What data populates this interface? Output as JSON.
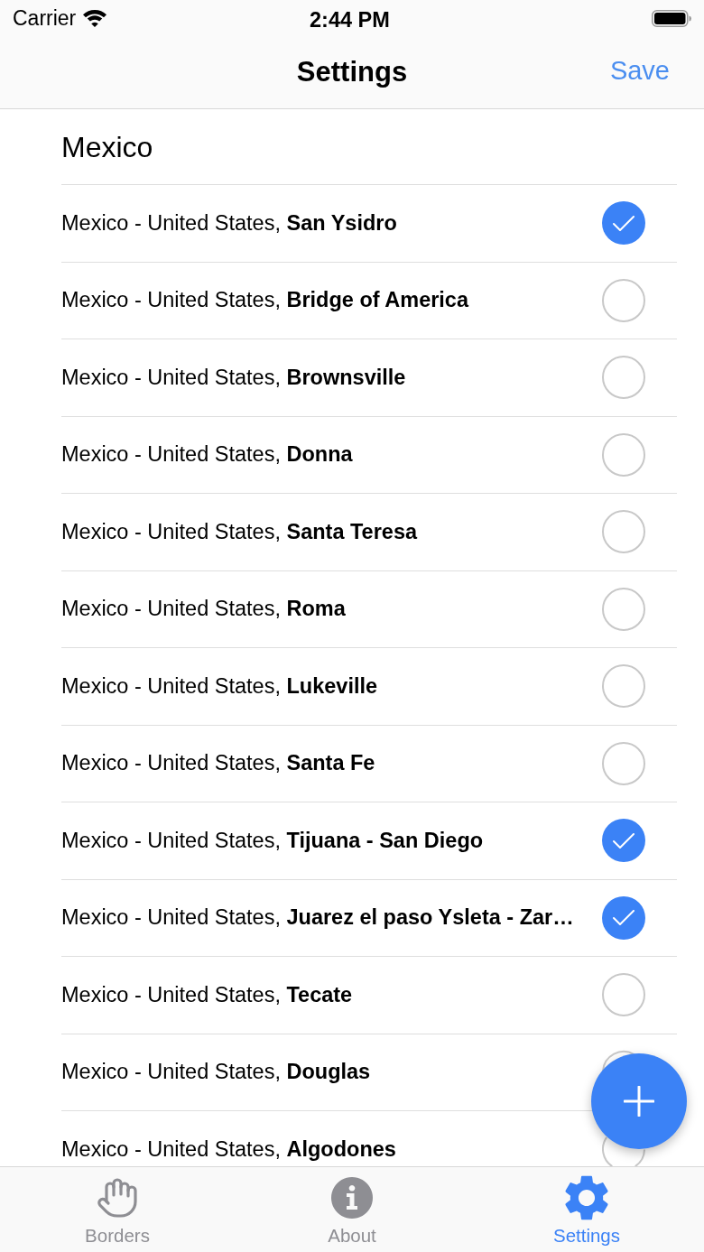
{
  "status_bar": {
    "carrier": "Carrier",
    "time": "2:44 PM"
  },
  "nav_bar": {
    "title": "Settings",
    "action": "Save"
  },
  "section": {
    "title": "Mexico",
    "rows": [
      {
        "text": "Mexico - United States, **San Ysidro**",
        "selected": true
      },
      {
        "text": "Mexico - United States, **Bridge of America**",
        "selected": false
      },
      {
        "text": "Mexico - United States, **Brownsville**",
        "selected": false
      },
      {
        "text": "Mexico - United States, **Donna**",
        "selected": false
      },
      {
        "text": "Mexico - United States, **Santa Teresa**",
        "selected": false
      },
      {
        "text": "Mexico - United States, **Roma**",
        "selected": false
      },
      {
        "text": "Mexico - United States, **Lukeville**",
        "selected": false
      },
      {
        "text": "Mexico - United States, **Santa Fe**",
        "selected": false
      },
      {
        "text": "Mexico - United States, **Tijuana - San Diego**",
        "selected": true
      },
      {
        "text": "Mexico - United States, **Juarez el paso Ysleta - Zar…**",
        "selected": true
      },
      {
        "text": "Mexico - United States, **Tecate**",
        "selected": false
      },
      {
        "text": "Mexico - United States, **Douglas**",
        "selected": false
      },
      {
        "text": "Mexico - United States, **Algodones**",
        "selected": false
      }
    ]
  },
  "tab_bar": {
    "tabs": [
      {
        "label": "Borders",
        "selected": false
      },
      {
        "label": "About",
        "selected": false
      },
      {
        "label": "Settings",
        "selected": true
      }
    ]
  }
}
